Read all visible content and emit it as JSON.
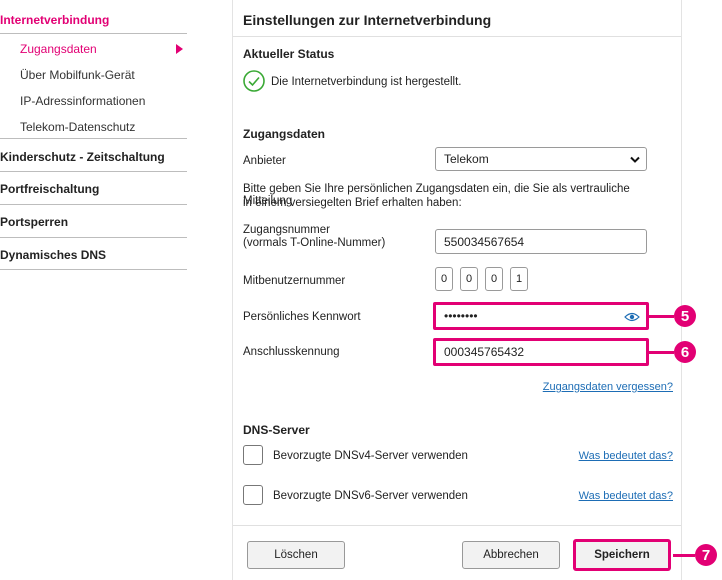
{
  "sidebar": {
    "section_internet": "Internetverbindung",
    "items": [
      {
        "label": "Zugangsdaten"
      },
      {
        "label": "Über Mobilfunk-Gerät"
      },
      {
        "label": "IP-Adressinformationen"
      },
      {
        "label": "Telekom-Datenschutz"
      }
    ],
    "sections": [
      {
        "label": "Kinderschutz - Zeitschaltung"
      },
      {
        "label": "Portfreischaltung"
      },
      {
        "label": "Portsperren"
      },
      {
        "label": "Dynamisches DNS"
      }
    ]
  },
  "main": {
    "title": "Einstellungen zur Internetverbindung",
    "status": {
      "heading": "Aktueller Status",
      "text": "Die Internetverbindung ist hergestellt."
    },
    "access": {
      "heading": "Zugangsdaten",
      "provider_label": "Anbieter",
      "provider_value": "Telekom",
      "instructions_line1": "Bitte geben Sie Ihre persönlichen Zugangsdaten ein, die Sie als vertrauliche Mitteilung",
      "instructions_line2": "in einem versiegelten Brief erhalten haben:",
      "number_label_line1": "Zugangsnummer",
      "number_label_line2": "(vormals T-Online-Nummer)",
      "number_value": "550034567654",
      "co_user_label": "Mitbenutzernummer",
      "co_user_digits": [
        "0",
        "0",
        "0",
        "1"
      ],
      "password_label": "Persönliches Kennwort",
      "password_value": "••••••••",
      "connection_id_label": "Anschlusskennung",
      "connection_id_value": "000345765432",
      "forgot_link": "Zugangsdaten vergessen?"
    },
    "dns": {
      "heading": "DNS-Server",
      "v4_label": "Bevorzugte DNSv4-Server verwenden",
      "v6_label": "Bevorzugte DNSv6-Server verwenden",
      "help_link": "Was bedeutet das?"
    },
    "buttons": {
      "delete": "Löschen",
      "cancel": "Abbrechen",
      "save": "Speichern"
    }
  },
  "callouts": [
    "5",
    "6",
    "7"
  ],
  "colors": {
    "accent": "#e20074",
    "link": "#1d6db5",
    "success": "#3aa935"
  },
  "icons": [
    "sidebar-arrow-icon",
    "status-check-icon",
    "dropdown-chevron-icon",
    "eye-icon"
  ]
}
